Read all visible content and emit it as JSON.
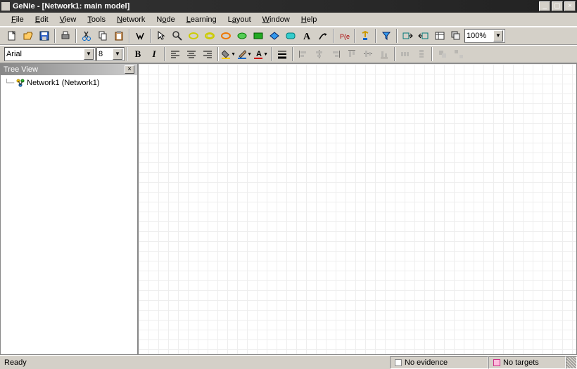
{
  "window": {
    "title": "GeNIe - [Network1: main model]"
  },
  "menus": {
    "file": "File",
    "edit": "Edit",
    "view": "View",
    "tools": "Tools",
    "network": "Network",
    "node": "Node",
    "learning": "Learning",
    "layout": "Layout",
    "window": "Window",
    "help": "Help"
  },
  "toolbar": {
    "zoom": "100%"
  },
  "format": {
    "font": "Arial",
    "size": "8"
  },
  "tree": {
    "title": "Tree View",
    "root": "Network1 (Network1)"
  },
  "status": {
    "ready": "Ready",
    "evidence": "No evidence",
    "targets": "No targets"
  }
}
